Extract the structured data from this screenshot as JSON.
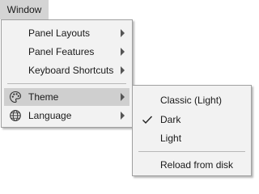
{
  "menubar": {
    "window_label": "Window"
  },
  "window_menu": {
    "items": [
      {
        "label": "Panel Layouts",
        "has_submenu": true
      },
      {
        "label": "Panel Features",
        "has_submenu": true
      },
      {
        "label": "Keyboard Shortcuts",
        "has_submenu": true
      },
      {
        "label": "Theme",
        "has_submenu": true,
        "icon": "palette-icon",
        "highlighted": true
      },
      {
        "label": "Language",
        "has_submenu": true,
        "icon": "globe-icon"
      }
    ]
  },
  "theme_submenu": {
    "items": [
      {
        "label": "Classic (Light)",
        "checked": false
      },
      {
        "label": "Dark",
        "checked": true
      },
      {
        "label": "Light",
        "checked": false
      },
      {
        "label": "Reload from disk",
        "checked": false
      }
    ]
  },
  "colors": {
    "menu_background": "#f2f2f2",
    "highlight": "#cfcfcf",
    "menubar_active": "#d4d4d4"
  }
}
